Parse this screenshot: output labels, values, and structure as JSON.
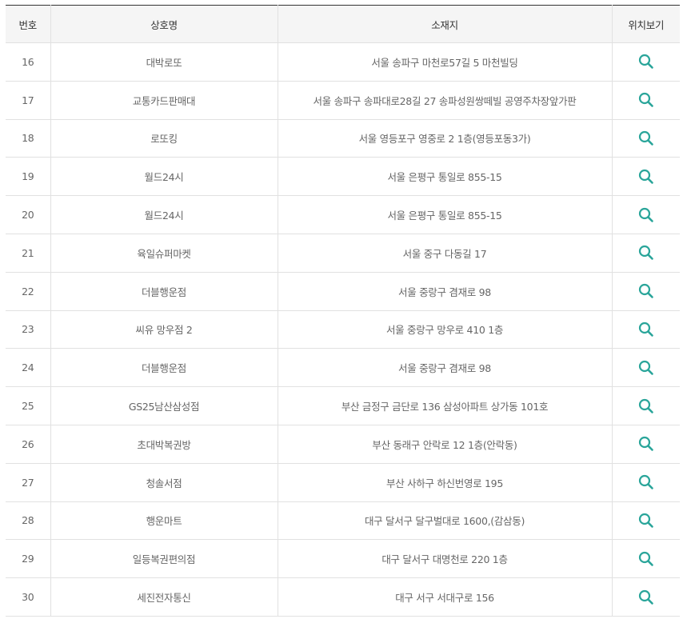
{
  "table": {
    "headers": {
      "no": "번호",
      "name": "상호명",
      "address": "소재지",
      "location": "위치보기"
    },
    "icon": "search-icon",
    "accent_color": "#2aa59a",
    "rows": [
      {
        "no": "16",
        "name": "대박로또",
        "address": "서울 송파구 마천로57길 5 마천빌딩"
      },
      {
        "no": "17",
        "name": "교통카드판매대",
        "address": "서울 송파구 송파대로28길 27 송파성원쌍떼빌 공영주차장앞가판"
      },
      {
        "no": "18",
        "name": "로또킹",
        "address": "서울 영등포구 영중로 2 1층(영등포동3가)"
      },
      {
        "no": "19",
        "name": "월드24시",
        "address": "서울 은평구 통일로 855-15"
      },
      {
        "no": "20",
        "name": "월드24시",
        "address": "서울 은평구 통일로 855-15"
      },
      {
        "no": "21",
        "name": "육일슈퍼마켓",
        "address": "서울 중구 다동길 17"
      },
      {
        "no": "22",
        "name": "더블행운점",
        "address": "서울 중랑구 겸재로 98"
      },
      {
        "no": "23",
        "name": "씨유 망우점 2",
        "address": "서울 중랑구 망우로 410 1층"
      },
      {
        "no": "24",
        "name": "더블행운점",
        "address": "서울 중랑구 겸재로 98"
      },
      {
        "no": "25",
        "name": "GS25남산삼성점",
        "address": "부산 금정구 금단로 136 삼성아파트 상가동 101호"
      },
      {
        "no": "26",
        "name": "초대박복권방",
        "address": "부산 동래구 안락로 12 1층(안락동)"
      },
      {
        "no": "27",
        "name": "청솔서점",
        "address": "부산 사하구 하신번영로 195"
      },
      {
        "no": "28",
        "name": "행운마트",
        "address": "대구 달서구 달구벌대로 1600,(감삼동)"
      },
      {
        "no": "29",
        "name": "일등복권편의점",
        "address": "대구 달서구 대명천로 220 1층"
      },
      {
        "no": "30",
        "name": "세진전자통신",
        "address": "대구 서구 서대구로 156"
      }
    ]
  }
}
